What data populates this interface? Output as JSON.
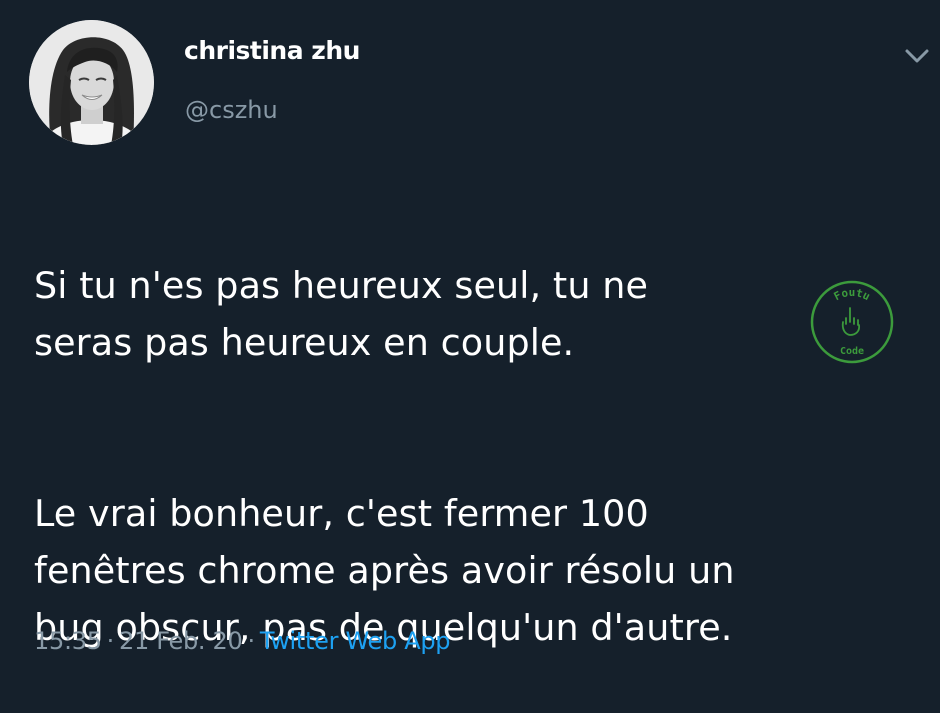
{
  "author": {
    "display_name": "christina zhu",
    "handle": "@cszhu",
    "avatar_icon": "profile-photo"
  },
  "menu_icon": "chevron-down-icon",
  "tweet": {
    "paragraph_1": "Si tu n'es pas heureux seul, tu ne\nseras pas heureux en couple.",
    "paragraph_2": "Le vrai bonheur, c'est fermer 100\nfenêtres chrome après avoir résolu un\nbug obscur, pas de quelqu'un d'autre."
  },
  "meta": {
    "time": "15:35",
    "separator": "·",
    "date": "21 Feb. 20",
    "source": "Twitter Web App"
  },
  "watermark": {
    "top_text": "Foutu",
    "bottom_text": "Code",
    "color": "#3c9b3c"
  },
  "colors": {
    "background": "#15202b",
    "text": "#ffffff",
    "secondary_text": "#8899a6",
    "link": "#1da1f2"
  }
}
